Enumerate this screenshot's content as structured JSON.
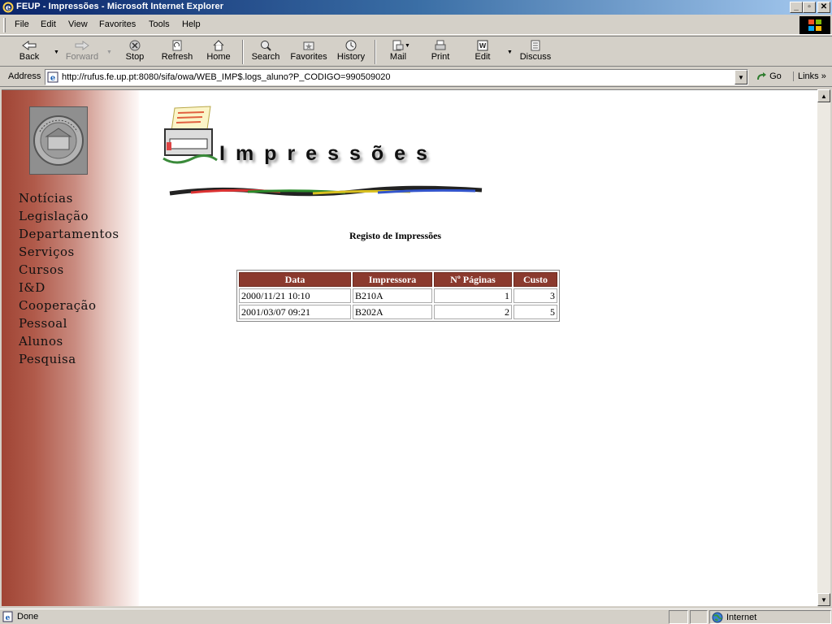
{
  "window": {
    "title": "FEUP - Impressões - Microsoft Internet Explorer",
    "controls": [
      "minimize",
      "maximize",
      "close"
    ]
  },
  "menu": [
    "File",
    "Edit",
    "View",
    "Favorites",
    "Tools",
    "Help"
  ],
  "toolbar": {
    "back": "Back",
    "forward": "Forward",
    "stop": "Stop",
    "refresh": "Refresh",
    "home": "Home",
    "search": "Search",
    "favorites": "Favorites",
    "history": "History",
    "mail": "Mail",
    "print": "Print",
    "edit": "Edit",
    "discuss": "Discuss"
  },
  "address": {
    "label": "Address",
    "url": "http://rufus.fe.up.pt:8080/sifa/owa/WEB_IMP$.logs_aluno?P_CODIGO=990509020",
    "go": "Go",
    "links": "Links"
  },
  "sidebar": {
    "items": [
      "Notícias",
      "Legislação",
      "Departamentos",
      "Serviços",
      "Cursos",
      "I&D",
      "Cooperação",
      "Pessoal",
      "Alunos",
      "Pesquisa"
    ]
  },
  "page": {
    "logo_title": "Impressões",
    "heading": "Registo de Impressões",
    "table": {
      "headers": [
        "Data",
        "Impressora",
        "Nº Páginas",
        "Custo"
      ],
      "rows": [
        [
          "2000/11/21 10:10",
          "B210A",
          "1",
          "3"
        ],
        [
          "2001/03/07 09:21",
          "B202A",
          "2",
          "5"
        ]
      ]
    }
  },
  "status": {
    "text": "Done",
    "zone": "Internet"
  },
  "colors": {
    "table_header": "#8b3a2e",
    "sidebar_dark": "#a04535",
    "titlebar": "#0a246a"
  }
}
